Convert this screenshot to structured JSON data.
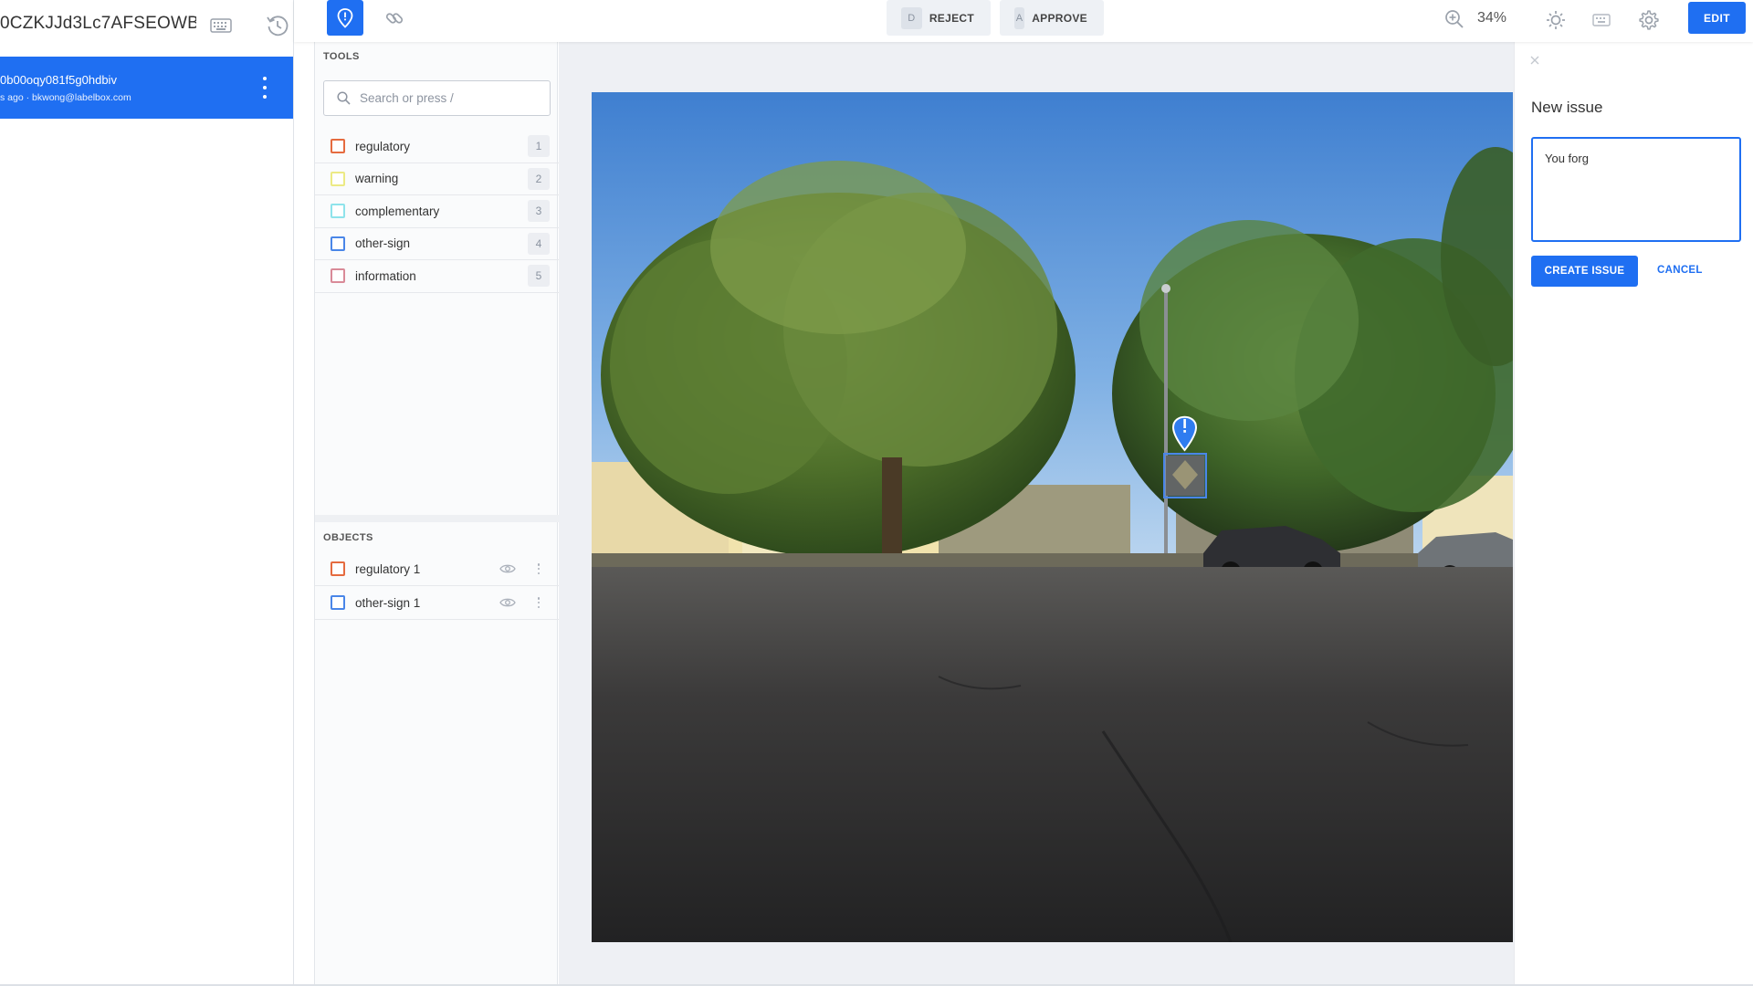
{
  "app": {
    "row_id": "0CZKJJd3Lc7AFSEOWB...",
    "review": {
      "id": "0b00oqy081f5g0hdbiv",
      "meta": "s ago · bkwong@labelbox.com"
    }
  },
  "toolbar": {
    "reject": {
      "key": "D",
      "label": "REJECT"
    },
    "approve": {
      "key": "A",
      "label": "APPROVE"
    },
    "zoom": "34%",
    "edit_label": "EDIT"
  },
  "tools": {
    "title": "TOOLS",
    "search_placeholder": "Search or press /",
    "items": [
      {
        "label": "regulatory",
        "key": "1",
        "color": "#e56b3f"
      },
      {
        "label": "warning",
        "key": "2",
        "color": "#ecea85"
      },
      {
        "label": "complementary",
        "key": "3",
        "color": "#8fe3eb"
      },
      {
        "label": "other-sign",
        "key": "4",
        "color": "#4a86e8"
      },
      {
        "label": "information",
        "key": "5",
        "color": "#d98a98"
      }
    ]
  },
  "objects": {
    "title": "OBJECTS",
    "items": [
      {
        "label": "regulatory 1",
        "color": "#e56b3f"
      },
      {
        "label": "other-sign 1",
        "color": "#4a86e8"
      }
    ]
  },
  "issue": {
    "title": "New issue",
    "text": "You forg",
    "create_label": "CREATE ISSUE",
    "cancel_label": "CANCEL"
  },
  "icons": [
    "keyboard-icon",
    "history-icon",
    "more-vertical-icon",
    "issue-pin-icon",
    "link-icon",
    "search-icon",
    "zoom-in-icon",
    "brightness-icon",
    "settings-icon",
    "eye-icon",
    "close-icon"
  ],
  "colors": {
    "accent": "#1f6ff2"
  }
}
